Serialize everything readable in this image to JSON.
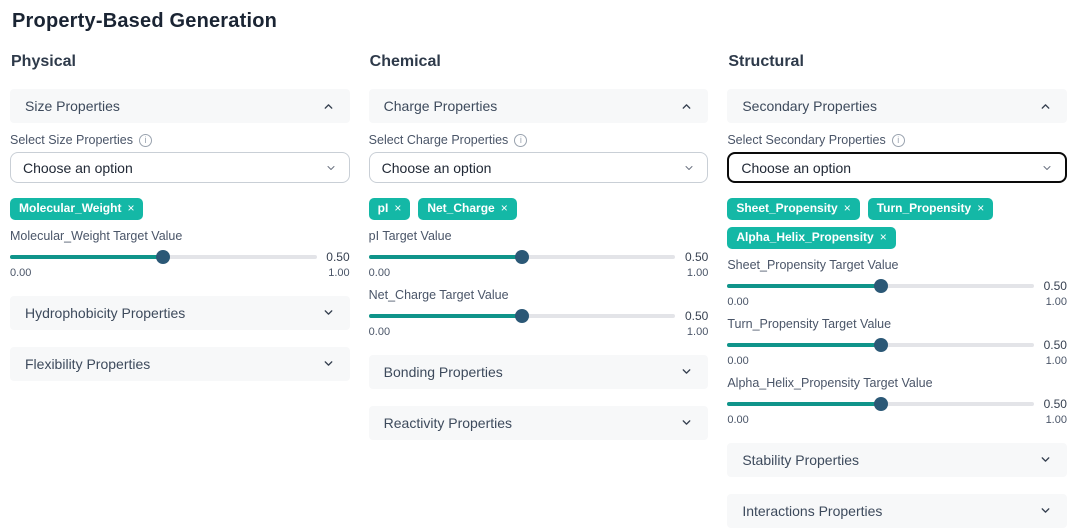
{
  "page": {
    "title": "Property-Based Generation"
  },
  "icons": {
    "tag_remove": "×",
    "info": "i"
  },
  "colors": {
    "accent_teal": "#14b8a6",
    "slider_fill": "#0f948a",
    "slider_handle": "#2b5876",
    "accordion_bg": "#f7f8f9",
    "focused_select_border": "#0a0a0a"
  },
  "columns": [
    {
      "heading": "Physical",
      "section": {
        "title": "Size Properties",
        "select_label": "Select Size Properties",
        "select_value": "Choose an option",
        "tags": [
          "Molecular_Weight"
        ],
        "sliders": [
          {
            "label": "Molecular_Weight Target Value",
            "value": "0.50",
            "min": "0.00",
            "max": "1.00",
            "percent": 50
          }
        ]
      },
      "collapsed": [
        "Hydrophobicity Properties",
        "Flexibility Properties"
      ]
    },
    {
      "heading": "Chemical",
      "section": {
        "title": "Charge Properties",
        "select_label": "Select Charge Properties",
        "select_value": "Choose an option",
        "tags": [
          "pI",
          "Net_Charge"
        ],
        "sliders": [
          {
            "label": "pI Target Value",
            "value": "0.50",
            "min": "0.00",
            "max": "1.00",
            "percent": 50
          },
          {
            "label": "Net_Charge Target Value",
            "value": "0.50",
            "min": "0.00",
            "max": "1.00",
            "percent": 50
          }
        ]
      },
      "collapsed": [
        "Bonding Properties",
        "Reactivity Properties"
      ]
    },
    {
      "heading": "Structural",
      "section": {
        "title": "Secondary Properties",
        "select_label": "Select Secondary Properties",
        "select_value": "Choose an option",
        "tags": [
          "Sheet_Propensity",
          "Turn_Propensity",
          "Alpha_Helix_Propensity"
        ],
        "sliders": [
          {
            "label": "Sheet_Propensity Target Value",
            "value": "0.50",
            "min": "0.00",
            "max": "1.00",
            "percent": 50
          },
          {
            "label": "Turn_Propensity Target Value",
            "value": "0.50",
            "min": "0.00",
            "max": "1.00",
            "percent": 50
          },
          {
            "label": "Alpha_Helix_Propensity Target Value",
            "value": "0.50",
            "min": "0.00",
            "max": "1.00",
            "percent": 50
          }
        ]
      },
      "collapsed": [
        "Stability Properties",
        "Interactions Properties"
      ]
    }
  ]
}
